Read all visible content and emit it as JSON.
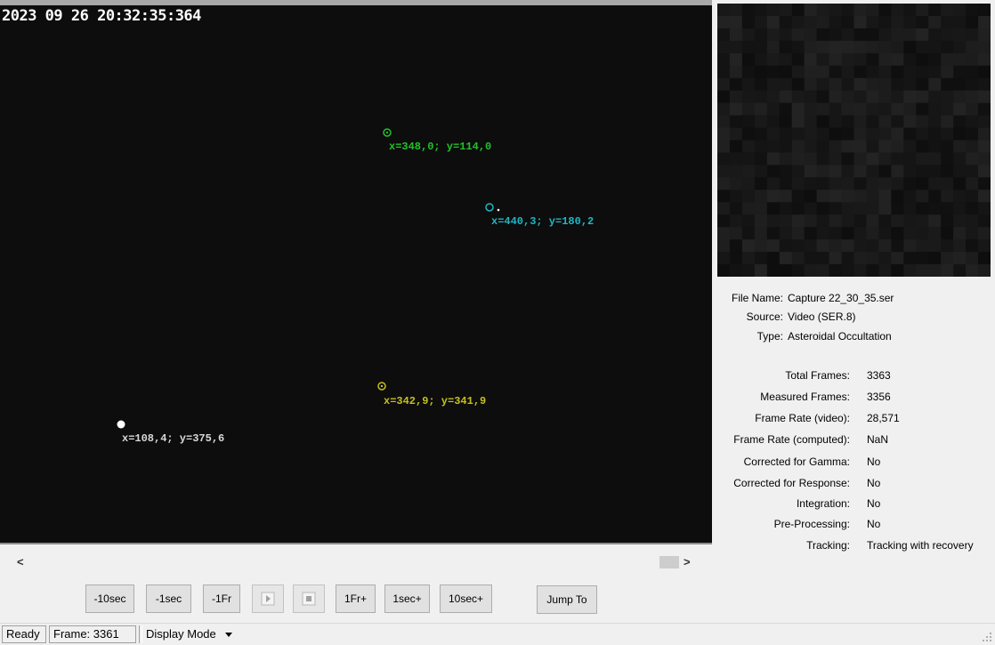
{
  "video": {
    "timestamp": "2023 09 26 20:32:35:364",
    "targets": [
      {
        "label": "x=348,0; y=114,0",
        "color": "#22c02a"
      },
      {
        "label": "x=440,3; y=180,2",
        "color": "#1fb6c4"
      },
      {
        "label": "x=342,9; y=341,9",
        "color": "#c4c01e"
      },
      {
        "label": "x=108,4; y=375,6",
        "color": "#d8d8d8"
      }
    ]
  },
  "info": {
    "file_name_label": "File Name:",
    "file_name": "Capture 22_30_35.ser",
    "source_label": "Source:",
    "source": "Video (SER.8)",
    "type_label": "Type:",
    "type": "Asteroidal Occultation",
    "rows": [
      {
        "key": "Total Frames:",
        "value": "3363"
      },
      {
        "key": "Measured Frames:",
        "value": "3356"
      },
      {
        "key": "Frame Rate (video):",
        "value": "28,571"
      },
      {
        "key": "Frame Rate (computed):",
        "value": "NaN"
      },
      {
        "key": "Corrected for Gamma:",
        "value": "No"
      },
      {
        "key": "Corrected for Response:",
        "value": "No"
      },
      {
        "key": "Integration:",
        "value": "No"
      },
      {
        "key": "Pre-Processing:",
        "value": "No"
      },
      {
        "key": "Tracking:",
        "value": "Tracking with recovery"
      }
    ]
  },
  "scroll": {
    "left": "<",
    "right": ">"
  },
  "controls": {
    "minus10sec": "-10sec",
    "minus1sec": "-1sec",
    "minus1fr": "-1Fr",
    "plus1fr": "1Fr+",
    "plus1sec": "1sec+",
    "plus10sec": "10sec+",
    "jump_to": "Jump To"
  },
  "status": {
    "state": "Ready",
    "frame": "Frame: 3361",
    "display_mode": "Display Mode"
  },
  "icons": [
    "play-icon",
    "stop-icon",
    "dropdown-arrow-icon",
    "resize-grip-icon"
  ]
}
